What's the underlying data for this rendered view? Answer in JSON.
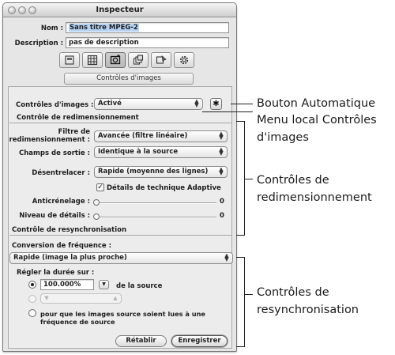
{
  "window": {
    "title": "Inspecteur"
  },
  "fields": {
    "name_label": "Nom :",
    "name_value": "Sans titre MPEG-2",
    "description_label": "Description :",
    "description_value": "pas de description"
  },
  "toolbar": {
    "buttons": [
      "display-icon",
      "grid-icon",
      "image-controls-icon",
      "layers-icon",
      "filter-icon",
      "gear-icon"
    ],
    "active_index": 2
  },
  "section_tab": "Contrôles d'images",
  "image_controls": {
    "label": "Contrôles d'images :",
    "value": "Activé",
    "gear_symbol": "✱"
  },
  "resize": {
    "header": "Contrôle de redimensionnement",
    "filter_label_line1": "Filtre de",
    "filter_label_line2": "redimensionnement :",
    "filter_value": "Avancée (filtre linéaire)",
    "output_label": "Champs de sortie :",
    "output_value": "Identique à la source",
    "deinterlace_label": "Désentrelacer :",
    "deinterlace_value": "Rapide (moyenne des lignes)",
    "adaptive_label": "Détails de technique Adaptive",
    "adaptive_checked": true,
    "antialias_label": "Anticrénelage :",
    "antialias_value": "0",
    "detail_label": "Niveau de détails :",
    "detail_value": "0"
  },
  "resync": {
    "header": "Contrôle de resynchronisation",
    "frame_rate_label": "Conversion de fréquence :",
    "frame_rate_value": "Rapide (image la plus proche)",
    "duration_label": "Régler la durée sur :",
    "percent_value": "100.000%",
    "of_source": "de la source",
    "option3_line1": "pour que les images source soient lues à une",
    "option3_line2": "fréquence de source"
  },
  "buttons": {
    "revert": "Rétablir",
    "save": "Enregistrer"
  },
  "callouts": {
    "auto_button": "Bouton Automatique",
    "image_menu_line1": "Menu local Contrôles",
    "image_menu_line2": "d'images",
    "resize_line1": "Contrôles de",
    "resize_line2": "redimensionnement",
    "resync_line1": "Contrôles de",
    "resync_line2": "resynchronisation"
  }
}
